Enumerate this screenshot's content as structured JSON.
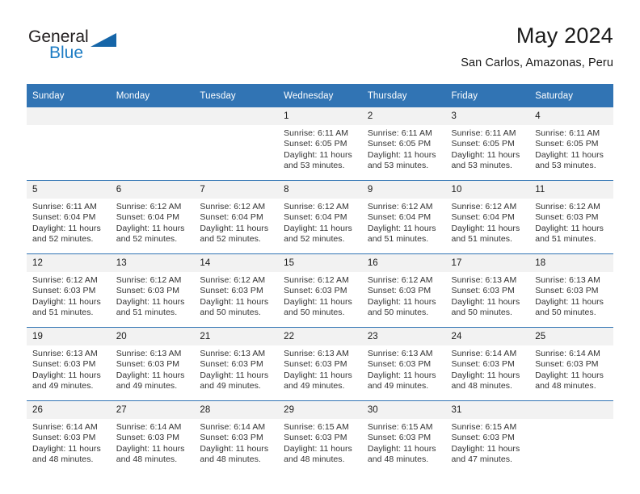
{
  "brand": {
    "name_top": "General",
    "name_bottom": "Blue",
    "logo_icon": "triangle-logo-icon",
    "accent_color": "#1c7cc4"
  },
  "header": {
    "title": "May 2024",
    "subtitle": "San Carlos, Amazonas, Peru"
  },
  "theme": {
    "header_blue": "#3174b4",
    "daynum_gray": "#f2f2f2",
    "text": "#333333"
  },
  "calendar": {
    "weekday_headers": [
      "Sunday",
      "Monday",
      "Tuesday",
      "Wednesday",
      "Thursday",
      "Friday",
      "Saturday"
    ],
    "weeks": [
      [
        {
          "day": "",
          "blank": true,
          "sunrise": "",
          "sunset": "",
          "daylight_1": "",
          "daylight_2": ""
        },
        {
          "day": "",
          "blank": true,
          "sunrise": "",
          "sunset": "",
          "daylight_1": "",
          "daylight_2": ""
        },
        {
          "day": "",
          "blank": true,
          "sunrise": "",
          "sunset": "",
          "daylight_1": "",
          "daylight_2": ""
        },
        {
          "day": "1",
          "blank": false,
          "sunrise": "Sunrise: 6:11 AM",
          "sunset": "Sunset: 6:05 PM",
          "daylight_1": "Daylight: 11 hours",
          "daylight_2": "and 53 minutes."
        },
        {
          "day": "2",
          "blank": false,
          "sunrise": "Sunrise: 6:11 AM",
          "sunset": "Sunset: 6:05 PM",
          "daylight_1": "Daylight: 11 hours",
          "daylight_2": "and 53 minutes."
        },
        {
          "day": "3",
          "blank": false,
          "sunrise": "Sunrise: 6:11 AM",
          "sunset": "Sunset: 6:05 PM",
          "daylight_1": "Daylight: 11 hours",
          "daylight_2": "and 53 minutes."
        },
        {
          "day": "4",
          "blank": false,
          "sunrise": "Sunrise: 6:11 AM",
          "sunset": "Sunset: 6:05 PM",
          "daylight_1": "Daylight: 11 hours",
          "daylight_2": "and 53 minutes."
        }
      ],
      [
        {
          "day": "5",
          "blank": false,
          "sunrise": "Sunrise: 6:11 AM",
          "sunset": "Sunset: 6:04 PM",
          "daylight_1": "Daylight: 11 hours",
          "daylight_2": "and 52 minutes."
        },
        {
          "day": "6",
          "blank": false,
          "sunrise": "Sunrise: 6:12 AM",
          "sunset": "Sunset: 6:04 PM",
          "daylight_1": "Daylight: 11 hours",
          "daylight_2": "and 52 minutes."
        },
        {
          "day": "7",
          "blank": false,
          "sunrise": "Sunrise: 6:12 AM",
          "sunset": "Sunset: 6:04 PM",
          "daylight_1": "Daylight: 11 hours",
          "daylight_2": "and 52 minutes."
        },
        {
          "day": "8",
          "blank": false,
          "sunrise": "Sunrise: 6:12 AM",
          "sunset": "Sunset: 6:04 PM",
          "daylight_1": "Daylight: 11 hours",
          "daylight_2": "and 52 minutes."
        },
        {
          "day": "9",
          "blank": false,
          "sunrise": "Sunrise: 6:12 AM",
          "sunset": "Sunset: 6:04 PM",
          "daylight_1": "Daylight: 11 hours",
          "daylight_2": "and 51 minutes."
        },
        {
          "day": "10",
          "blank": false,
          "sunrise": "Sunrise: 6:12 AM",
          "sunset": "Sunset: 6:04 PM",
          "daylight_1": "Daylight: 11 hours",
          "daylight_2": "and 51 minutes."
        },
        {
          "day": "11",
          "blank": false,
          "sunrise": "Sunrise: 6:12 AM",
          "sunset": "Sunset: 6:03 PM",
          "daylight_1": "Daylight: 11 hours",
          "daylight_2": "and 51 minutes."
        }
      ],
      [
        {
          "day": "12",
          "blank": false,
          "sunrise": "Sunrise: 6:12 AM",
          "sunset": "Sunset: 6:03 PM",
          "daylight_1": "Daylight: 11 hours",
          "daylight_2": "and 51 minutes."
        },
        {
          "day": "13",
          "blank": false,
          "sunrise": "Sunrise: 6:12 AM",
          "sunset": "Sunset: 6:03 PM",
          "daylight_1": "Daylight: 11 hours",
          "daylight_2": "and 51 minutes."
        },
        {
          "day": "14",
          "blank": false,
          "sunrise": "Sunrise: 6:12 AM",
          "sunset": "Sunset: 6:03 PM",
          "daylight_1": "Daylight: 11 hours",
          "daylight_2": "and 50 minutes."
        },
        {
          "day": "15",
          "blank": false,
          "sunrise": "Sunrise: 6:12 AM",
          "sunset": "Sunset: 6:03 PM",
          "daylight_1": "Daylight: 11 hours",
          "daylight_2": "and 50 minutes."
        },
        {
          "day": "16",
          "blank": false,
          "sunrise": "Sunrise: 6:12 AM",
          "sunset": "Sunset: 6:03 PM",
          "daylight_1": "Daylight: 11 hours",
          "daylight_2": "and 50 minutes."
        },
        {
          "day": "17",
          "blank": false,
          "sunrise": "Sunrise: 6:13 AM",
          "sunset": "Sunset: 6:03 PM",
          "daylight_1": "Daylight: 11 hours",
          "daylight_2": "and 50 minutes."
        },
        {
          "day": "18",
          "blank": false,
          "sunrise": "Sunrise: 6:13 AM",
          "sunset": "Sunset: 6:03 PM",
          "daylight_1": "Daylight: 11 hours",
          "daylight_2": "and 50 minutes."
        }
      ],
      [
        {
          "day": "19",
          "blank": false,
          "sunrise": "Sunrise: 6:13 AM",
          "sunset": "Sunset: 6:03 PM",
          "daylight_1": "Daylight: 11 hours",
          "daylight_2": "and 49 minutes."
        },
        {
          "day": "20",
          "blank": false,
          "sunrise": "Sunrise: 6:13 AM",
          "sunset": "Sunset: 6:03 PM",
          "daylight_1": "Daylight: 11 hours",
          "daylight_2": "and 49 minutes."
        },
        {
          "day": "21",
          "blank": false,
          "sunrise": "Sunrise: 6:13 AM",
          "sunset": "Sunset: 6:03 PM",
          "daylight_1": "Daylight: 11 hours",
          "daylight_2": "and 49 minutes."
        },
        {
          "day": "22",
          "blank": false,
          "sunrise": "Sunrise: 6:13 AM",
          "sunset": "Sunset: 6:03 PM",
          "daylight_1": "Daylight: 11 hours",
          "daylight_2": "and 49 minutes."
        },
        {
          "day": "23",
          "blank": false,
          "sunrise": "Sunrise: 6:13 AM",
          "sunset": "Sunset: 6:03 PM",
          "daylight_1": "Daylight: 11 hours",
          "daylight_2": "and 49 minutes."
        },
        {
          "day": "24",
          "blank": false,
          "sunrise": "Sunrise: 6:14 AM",
          "sunset": "Sunset: 6:03 PM",
          "daylight_1": "Daylight: 11 hours",
          "daylight_2": "and 48 minutes."
        },
        {
          "day": "25",
          "blank": false,
          "sunrise": "Sunrise: 6:14 AM",
          "sunset": "Sunset: 6:03 PM",
          "daylight_1": "Daylight: 11 hours",
          "daylight_2": "and 48 minutes."
        }
      ],
      [
        {
          "day": "26",
          "blank": false,
          "sunrise": "Sunrise: 6:14 AM",
          "sunset": "Sunset: 6:03 PM",
          "daylight_1": "Daylight: 11 hours",
          "daylight_2": "and 48 minutes."
        },
        {
          "day": "27",
          "blank": false,
          "sunrise": "Sunrise: 6:14 AM",
          "sunset": "Sunset: 6:03 PM",
          "daylight_1": "Daylight: 11 hours",
          "daylight_2": "and 48 minutes."
        },
        {
          "day": "28",
          "blank": false,
          "sunrise": "Sunrise: 6:14 AM",
          "sunset": "Sunset: 6:03 PM",
          "daylight_1": "Daylight: 11 hours",
          "daylight_2": "and 48 minutes."
        },
        {
          "day": "29",
          "blank": false,
          "sunrise": "Sunrise: 6:15 AM",
          "sunset": "Sunset: 6:03 PM",
          "daylight_1": "Daylight: 11 hours",
          "daylight_2": "and 48 minutes."
        },
        {
          "day": "30",
          "blank": false,
          "sunrise": "Sunrise: 6:15 AM",
          "sunset": "Sunset: 6:03 PM",
          "daylight_1": "Daylight: 11 hours",
          "daylight_2": "and 48 minutes."
        },
        {
          "day": "31",
          "blank": false,
          "sunrise": "Sunrise: 6:15 AM",
          "sunset": "Sunset: 6:03 PM",
          "daylight_1": "Daylight: 11 hours",
          "daylight_2": "and 47 minutes."
        },
        {
          "day": "",
          "blank": true,
          "sunrise": "",
          "sunset": "",
          "daylight_1": "",
          "daylight_2": ""
        }
      ]
    ]
  }
}
